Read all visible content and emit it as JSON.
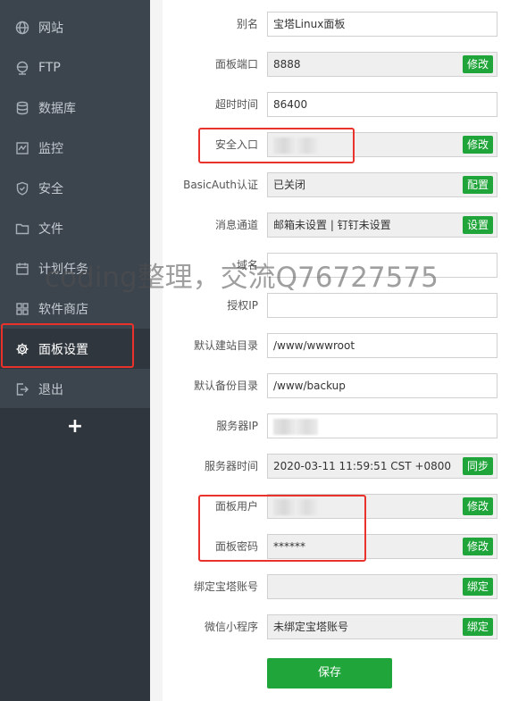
{
  "sidebar": {
    "items": [
      {
        "label": "网站",
        "icon": "globe-icon"
      },
      {
        "label": "FTP",
        "icon": "ftp-globe-icon"
      },
      {
        "label": "数据库",
        "icon": "database-icon"
      },
      {
        "label": "监控",
        "icon": "monitor-icon"
      },
      {
        "label": "安全",
        "icon": "shield-icon"
      },
      {
        "label": "文件",
        "icon": "folder-icon"
      },
      {
        "label": "计划任务",
        "icon": "calendar-icon"
      },
      {
        "label": "软件商店",
        "icon": "apps-grid-icon"
      },
      {
        "label": "面板设置",
        "icon": "gear-icon"
      },
      {
        "label": "退出",
        "icon": "logout-icon"
      }
    ],
    "add_label": "+"
  },
  "form": {
    "rows": [
      {
        "label": "别名",
        "value": "宝塔Linux面板",
        "button": ""
      },
      {
        "label": "面板端口",
        "value": "8888",
        "button": "修改"
      },
      {
        "label": "超时时间",
        "value": "86400",
        "button": ""
      },
      {
        "label": "安全入口",
        "value": "",
        "button": "修改"
      },
      {
        "label": "BasicAuth认证",
        "value": "已关闭",
        "button": "配置"
      },
      {
        "label": "消息通道",
        "value": "邮箱未设置 | 钉钉未设置",
        "button": "设置"
      },
      {
        "label": "域名",
        "value": "",
        "button": ""
      },
      {
        "label": "授权IP",
        "value": "",
        "button": ""
      },
      {
        "label": "默认建站目录",
        "value": "/www/wwwroot",
        "button": ""
      },
      {
        "label": "默认备份目录",
        "value": "/www/backup",
        "button": ""
      },
      {
        "label": "服务器IP",
        "value": "",
        "button": ""
      },
      {
        "label": "服务器时间",
        "value": "2020-03-11 11:59:51 CST +0800",
        "button": "同步"
      },
      {
        "label": "面板用户",
        "value": "",
        "button": "修改"
      },
      {
        "label": "面板密码",
        "value": "******",
        "button": "修改"
      },
      {
        "label": "绑定宝塔账号",
        "value": "",
        "button": "绑定"
      },
      {
        "label": "微信小程序",
        "value": "未绑定宝塔账号",
        "button": "绑定"
      }
    ],
    "save_label": "保存"
  },
  "watermark": "coding整理，交流Q76727575",
  "colors": {
    "sidebar": "#3c444d",
    "sidebar_active": "#2f363d",
    "accent_green": "#20a53a",
    "highlight_red": "#e8322b"
  }
}
